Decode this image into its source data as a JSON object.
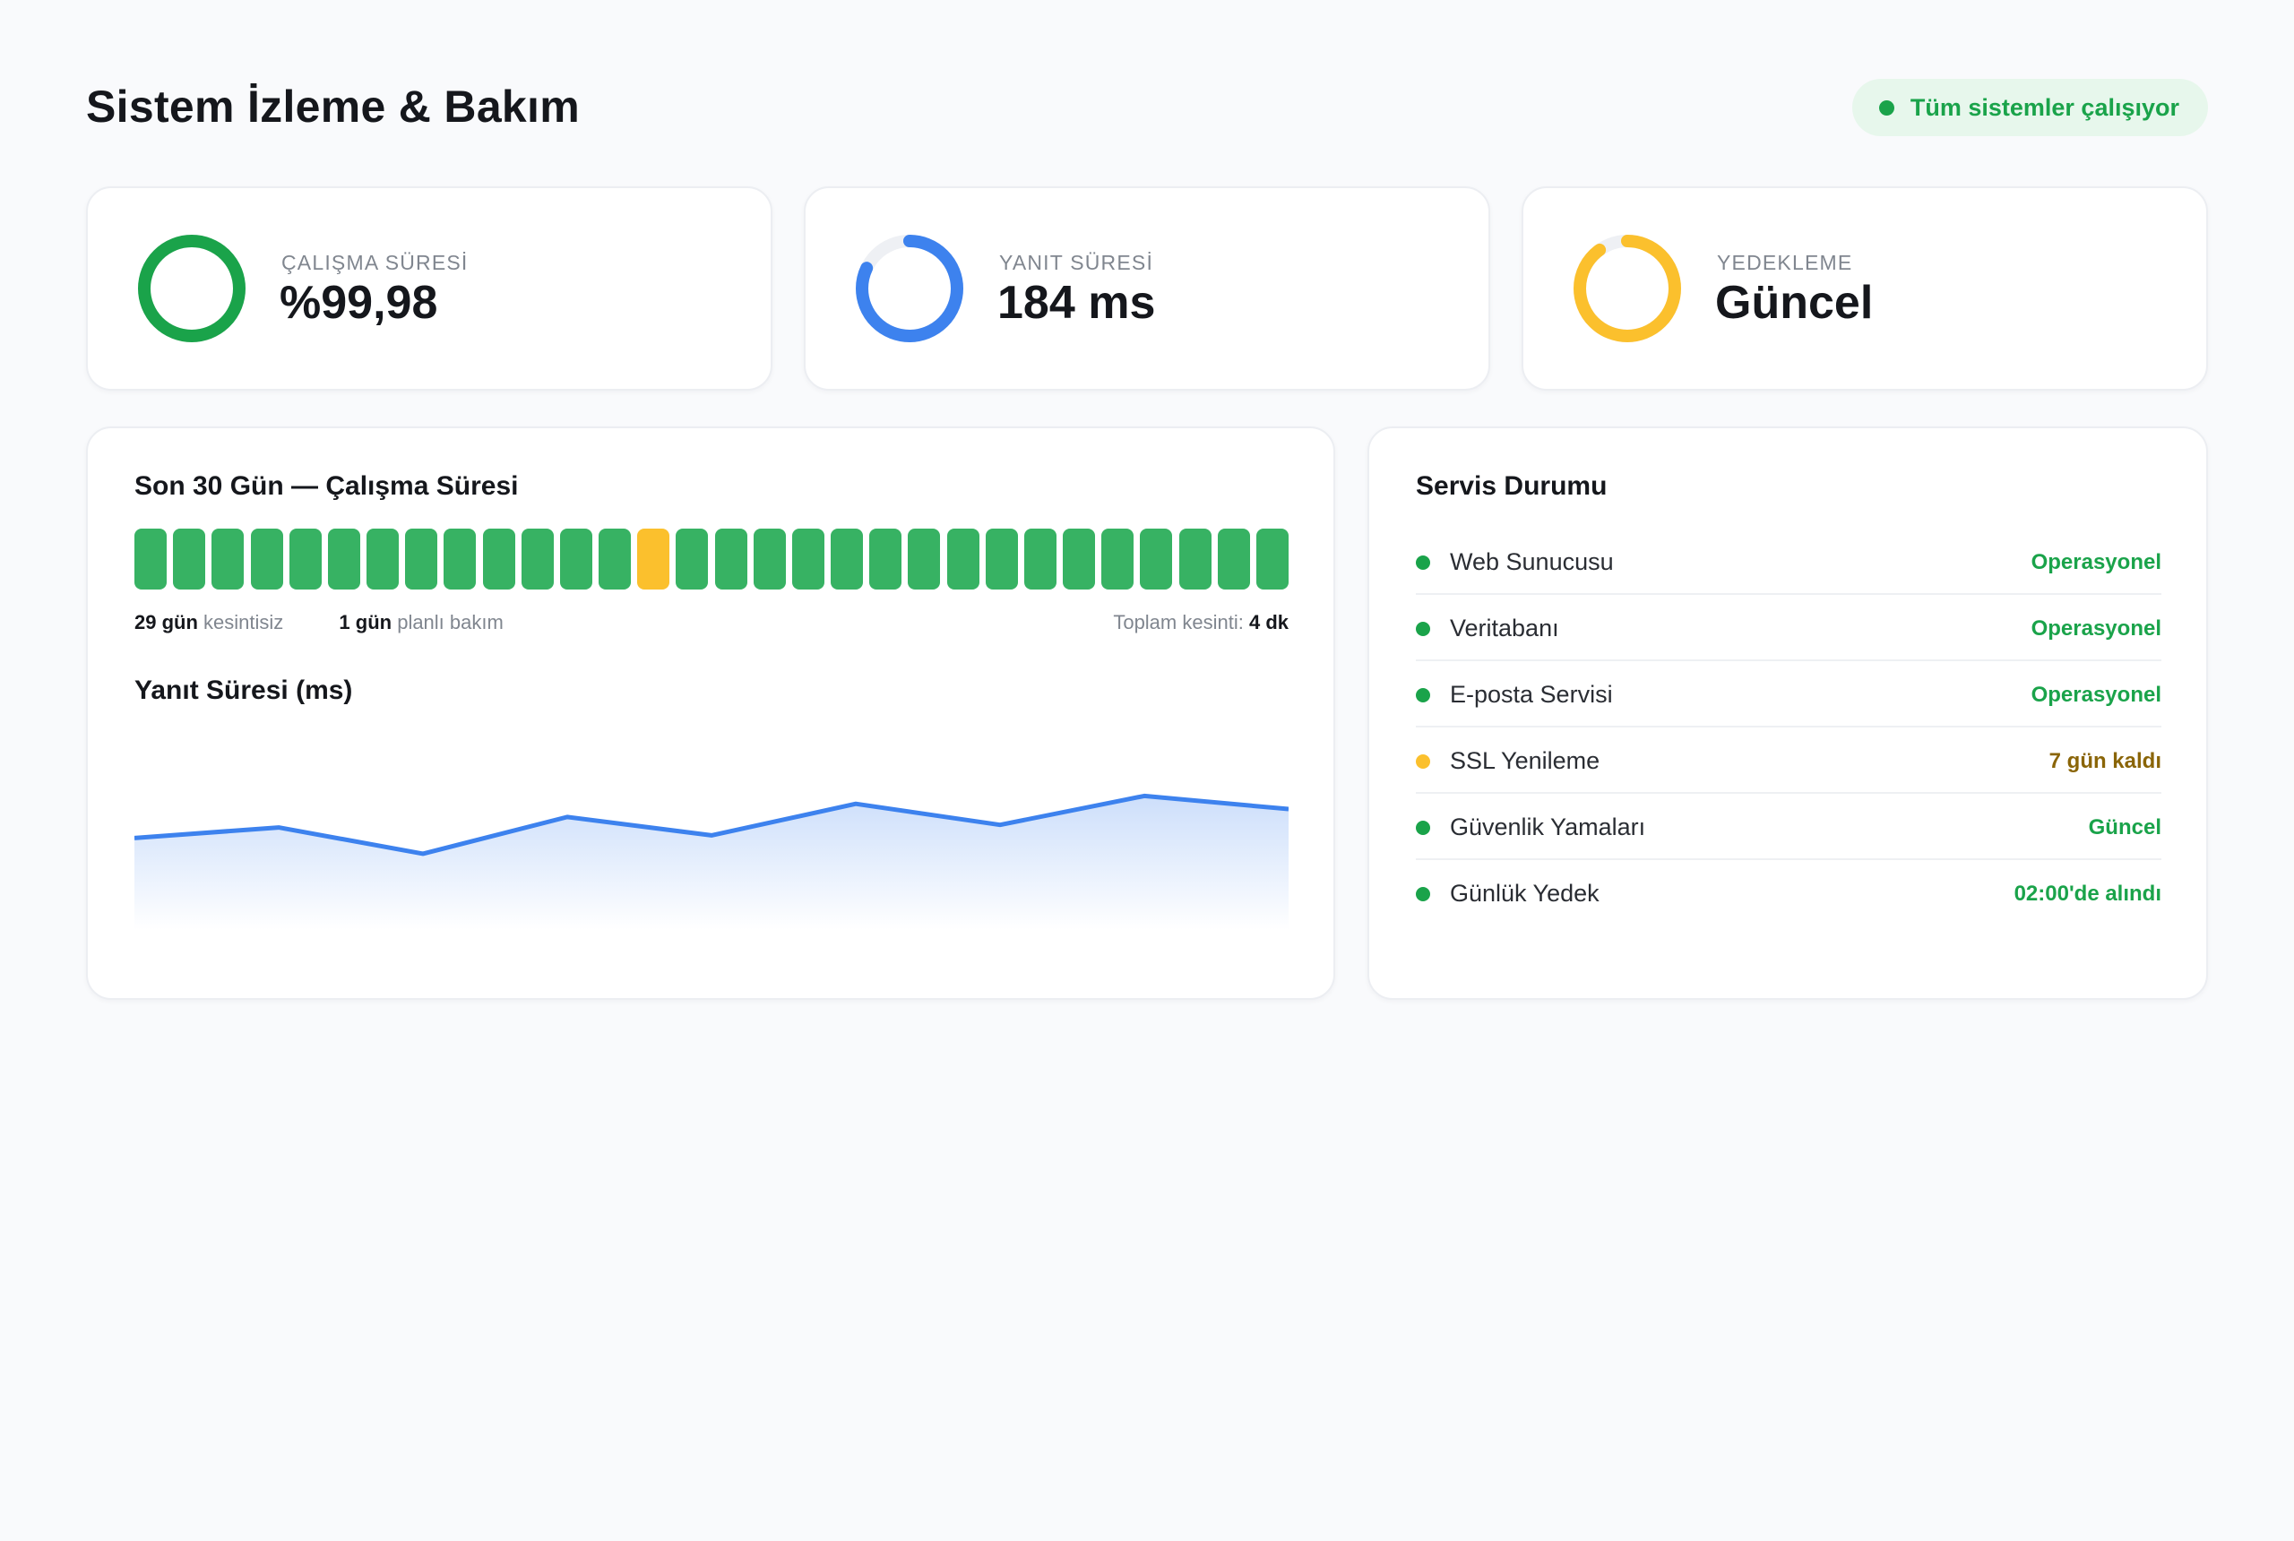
{
  "header": {
    "title": "Sistem İzleme & Bakım",
    "status": "Tüm sistemler çalışıyor"
  },
  "colors": {
    "ok": "#1aa34a",
    "bar_ok": "#37b263",
    "warn": "#fbc02d",
    "blue": "#3d82ee",
    "ring_track": "#eef0f4"
  },
  "stats": [
    {
      "label": "ÇALIŞMA SÜRESİ",
      "value": "%99,98",
      "fill": 0.9998,
      "color": "#1aa34a"
    },
    {
      "label": "YANIT SÜRESİ",
      "value": "184 ms",
      "fill": 0.82,
      "color": "#3d82ee"
    },
    {
      "label": "YEDEKLEME",
      "value": "Güncel",
      "fill": 0.9,
      "color": "#fbc02d"
    }
  ],
  "uptime": {
    "title": "Son 30 Gün — Çalışma Süresi",
    "days": [
      "ok",
      "ok",
      "ok",
      "ok",
      "ok",
      "ok",
      "ok",
      "ok",
      "ok",
      "ok",
      "ok",
      "ok",
      "ok",
      "maint",
      "ok",
      "ok",
      "ok",
      "ok",
      "ok",
      "ok",
      "ok",
      "ok",
      "ok",
      "ok",
      "ok",
      "ok",
      "ok",
      "ok",
      "ok",
      "ok"
    ],
    "uninterrupted_value": "29 gün",
    "uninterrupted_text": "kesintisiz",
    "maintenance_value": "1 gün",
    "maintenance_text": "planlı bakım",
    "total_label": "Toplam kesinti:",
    "total_value": "4 dk"
  },
  "response": {
    "title": "Yanıt Süresi (ms)",
    "chart_data": {
      "type": "area",
      "title": "Yanıt Süresi (ms)",
      "xlabel": "",
      "ylabel": "",
      "x": [
        1,
        2,
        3,
        4,
        5,
        6,
        7,
        8,
        9
      ],
      "values": [
        180,
        188,
        168,
        196,
        182,
        206,
        190,
        212,
        202
      ],
      "ylim": [
        110,
        260
      ],
      "grid": false
    }
  },
  "services": {
    "title": "Servis Durumu",
    "items": [
      {
        "name": "Web Sunucusu",
        "status": "Operasyonel",
        "level": "ok"
      },
      {
        "name": "Veritabanı",
        "status": "Operasyonel",
        "level": "ok"
      },
      {
        "name": "E-posta Servisi",
        "status": "Operasyonel",
        "level": "ok"
      },
      {
        "name": "SSL Yenileme",
        "status": "7 gün kaldı",
        "level": "warn"
      },
      {
        "name": "Güvenlik Yamaları",
        "status": "Güncel",
        "level": "ok"
      },
      {
        "name": "Günlük Yedek",
        "status": "02:00'de alındı",
        "level": "ok"
      }
    ]
  }
}
